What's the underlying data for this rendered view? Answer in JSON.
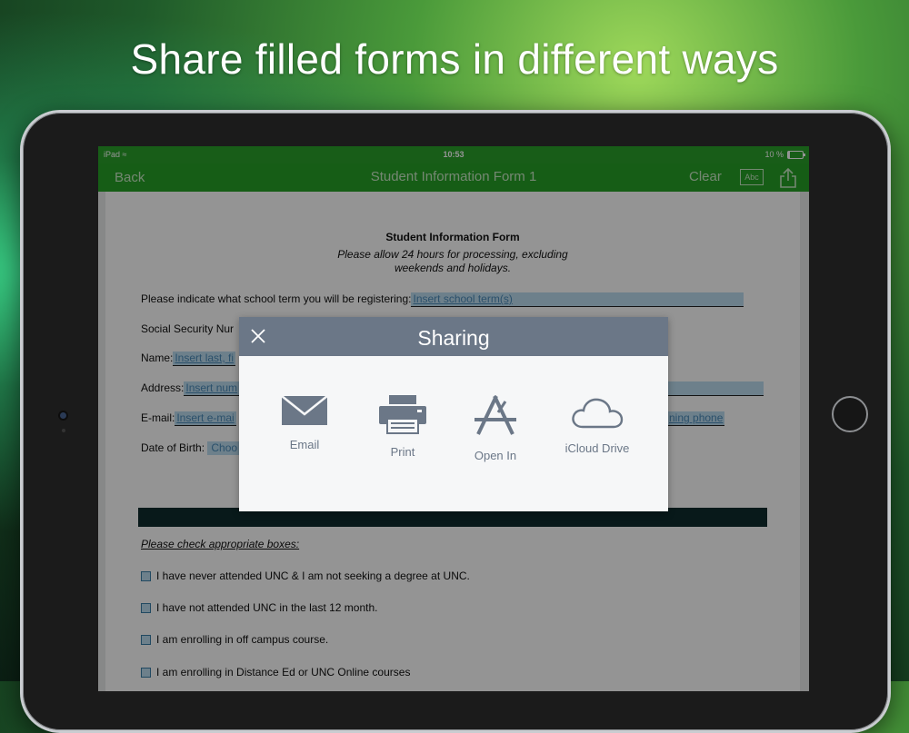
{
  "headline": "Share filled forms in different ways",
  "status": {
    "device": "iPad",
    "time": "10:53",
    "battery": "10 %"
  },
  "navbar": {
    "back": "Back",
    "title": "Student Information Form 1",
    "clear": "Clear",
    "abc": "Abc"
  },
  "form": {
    "title": "Student Information Form",
    "subtitle_line1": "Please allow 24 hours for processing, excluding",
    "subtitle_line2": "weekends and holidays.",
    "term_label": "Please indicate what school term you will be registering:",
    "term_placeholder": "Insert school term(s)",
    "ssn_label": "Social Security Nur",
    "name_label": "Name:",
    "name_placeholder": "Insert last, fi",
    "address_label": "Address:",
    "address_placeholder": "Insert num",
    "email_label": "E-mail:",
    "email_placeholder": "Insert e-mai",
    "phone_placeholder_tail": "ning phone",
    "dob_label": "Date of Birth:",
    "dob_placeholder": "Choo",
    "checks_title": "Please check appropriate boxes:",
    "checks": [
      "I have never attended UNC & I am not seeking a degree at UNC.",
      "I have not attended UNC in the last 12 month.",
      "I am enrolling in off campus course.",
      "I am enrolling in Distance Ed or UNC Online courses"
    ]
  },
  "sharing": {
    "title": "Sharing",
    "options": [
      {
        "label": "Email",
        "icon": "envelope-icon"
      },
      {
        "label": "Print",
        "icon": "printer-icon"
      },
      {
        "label": "Open In",
        "icon": "app-store-icon"
      },
      {
        "label": "iCloud Drive",
        "icon": "cloud-icon"
      }
    ]
  },
  "colors": {
    "nav_green": "#27a027",
    "modal_header": "#6b7787",
    "field_highlight": "#bcdcef",
    "icon_gray": "#6b7787"
  }
}
